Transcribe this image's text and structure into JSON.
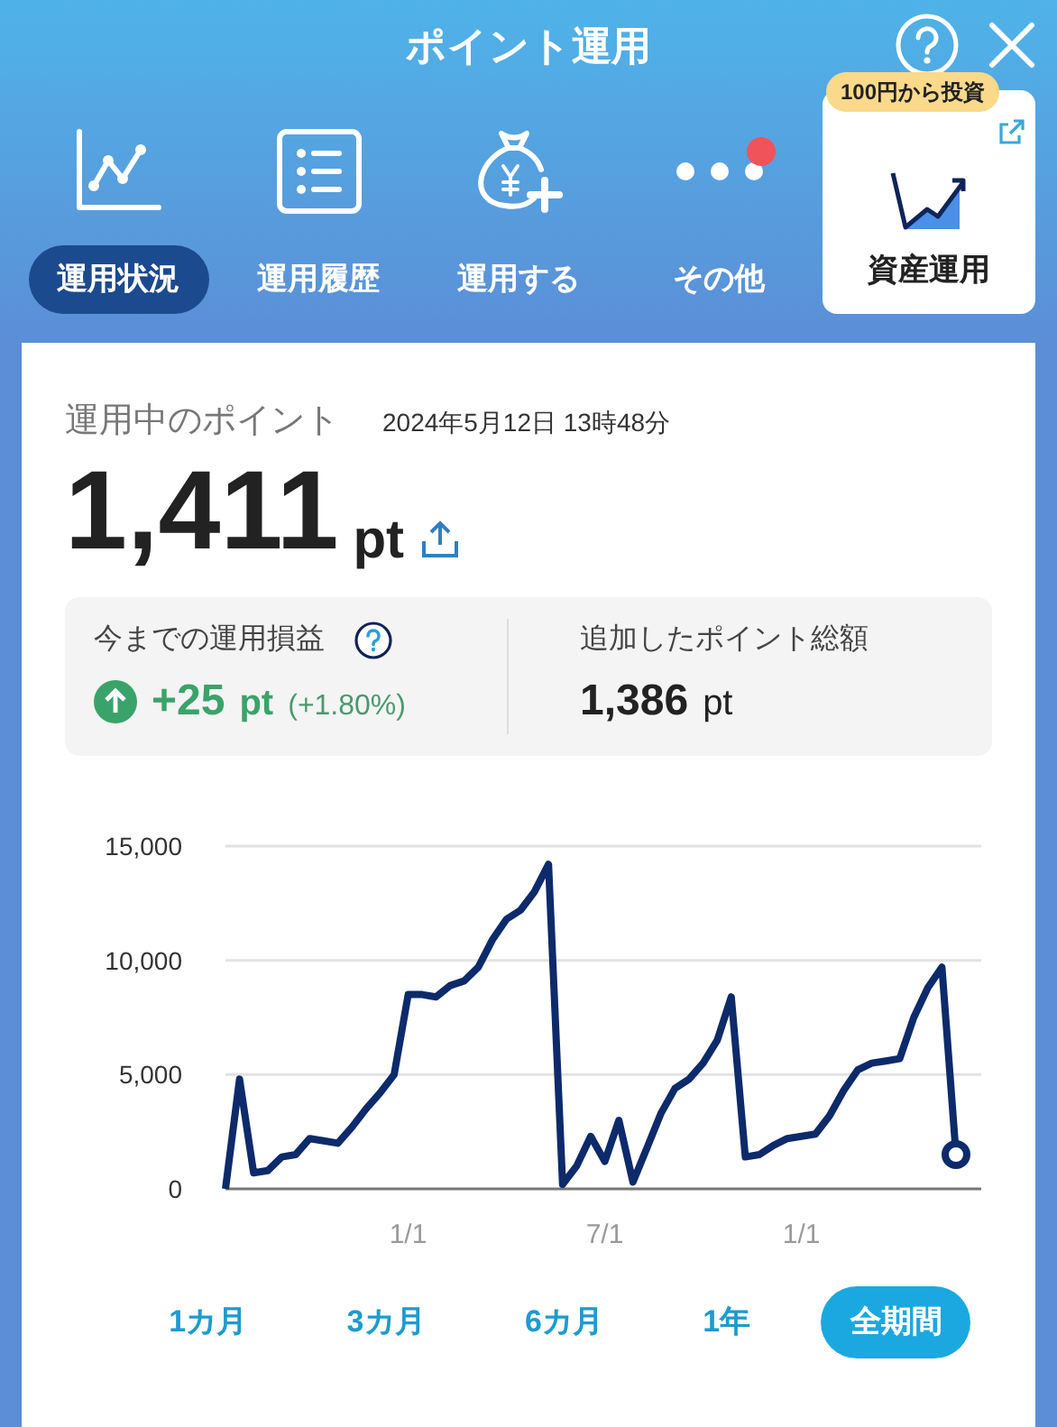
{
  "header": {
    "title": "ポイント運用"
  },
  "nav": [
    {
      "label": "運用状況",
      "kind": "chart",
      "selected": true,
      "dot": false
    },
    {
      "label": "運用履歴",
      "kind": "list",
      "selected": false,
      "dot": false
    },
    {
      "label": "運用する",
      "kind": "bag",
      "selected": false,
      "dot": false
    },
    {
      "label": "その他",
      "kind": "more",
      "selected": false,
      "dot": true
    }
  ],
  "promo": {
    "badge": "100円から投資",
    "label": "資産運用"
  },
  "summary": {
    "label": "運用中のポイント",
    "timestamp": "2024年5月12日 13時48分",
    "amount": "1,411",
    "unit": "pt"
  },
  "stats": [
    {
      "label": "今までの運用損益",
      "help": true,
      "kind": "gain",
      "value": "+25",
      "unit": "pt",
      "percent": "(+1.80%)"
    },
    {
      "label": "追加したポイント総額",
      "help": false,
      "kind": "total",
      "value": "1,386",
      "unit": "pt"
    }
  ],
  "chart_data": {
    "type": "line",
    "ylim": [
      0,
      15000
    ],
    "yticks": [
      {
        "value": 0,
        "label": "0"
      },
      {
        "value": 5000,
        "label": "5,000"
      },
      {
        "value": 10000,
        "label": "10,000"
      },
      {
        "value": 15000,
        "label": "15,000"
      }
    ],
    "categories": [
      null,
      null,
      null,
      null,
      null,
      null,
      null,
      null,
      null,
      null,
      null,
      null,
      null,
      "1/1",
      null,
      null,
      null,
      null,
      null,
      null,
      null,
      null,
      null,
      null,
      null,
      null,
      null,
      "7/1",
      null,
      null,
      null,
      null,
      null,
      null,
      null,
      null,
      null,
      null,
      null,
      null,
      null,
      "1/1",
      null,
      null,
      null,
      null,
      null,
      null,
      null,
      null,
      null,
      null,
      null
    ],
    "series": [
      {
        "color": "#0d2a6b",
        "values": [
          0,
          4800,
          700,
          800,
          1400,
          1500,
          2200,
          2100,
          2000,
          2700,
          3500,
          4200,
          5000,
          8500,
          8500,
          8400,
          8900,
          9100,
          9700,
          10900,
          11800,
          12200,
          13000,
          14200,
          200,
          1000,
          2300,
          1200,
          3000,
          300,
          1800,
          3300,
          4400,
          4800,
          5500,
          6500,
          8400,
          1400,
          1500,
          1900,
          2200,
          2300,
          2400,
          3200,
          4300,
          5200,
          5500,
          5600,
          5700,
          7500,
          8800,
          9700,
          1500
        ]
      }
    ]
  },
  "periods": [
    {
      "label": "1カ月",
      "selected": false
    },
    {
      "label": "3カ月",
      "selected": false
    },
    {
      "label": "6カ月",
      "selected": false
    },
    {
      "label": "1年",
      "selected": false
    },
    {
      "label": "全期間",
      "selected": true
    }
  ]
}
